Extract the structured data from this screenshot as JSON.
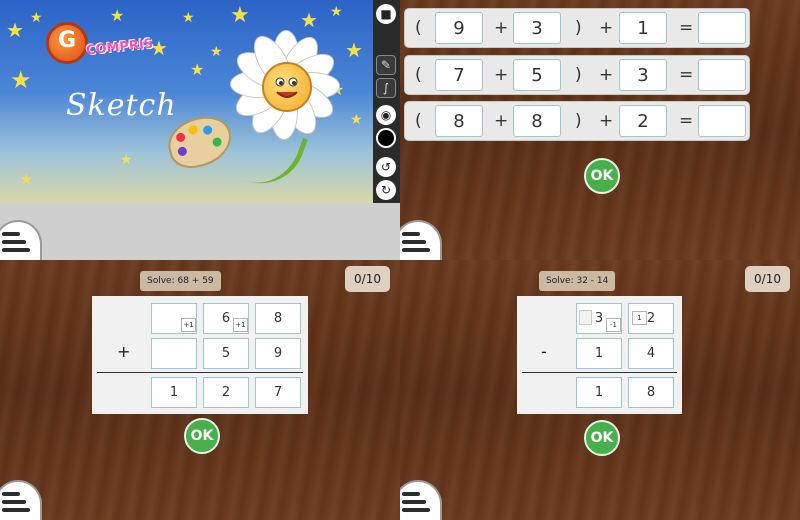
{
  "sketch": {
    "logo_letter": "G",
    "logo_text": "COMPRIS",
    "title": "Sketch",
    "tools": [
      "stop-icon",
      "page-icon",
      "brush-icon",
      "palette-icon",
      "color-black-icon",
      "undo-icon",
      "redo-icon"
    ]
  },
  "equations": {
    "rows": [
      {
        "open": "(",
        "a": "9",
        "op1": "+",
        "b": "3",
        "close": ")",
        "op2": "+",
        "c": "1",
        "eq": "=",
        "answer": ""
      },
      {
        "open": "(",
        "a": "7",
        "op1": "+",
        "b": "5",
        "close": ")",
        "op2": "+",
        "c": "3",
        "eq": "=",
        "answer": ""
      },
      {
        "open": "(",
        "a": "8",
        "op1": "+",
        "b": "8",
        "close": ")",
        "op2": "+",
        "c": "2",
        "eq": "=",
        "answer": ""
      }
    ],
    "ok_label": "OK"
  },
  "addition": {
    "prompt": "Solve: 68 + 59",
    "score": "0/10",
    "operator": "+",
    "row1": [
      "",
      "6",
      "8"
    ],
    "row1_carries": [
      "+1",
      "+1"
    ],
    "row2": [
      "",
      "5",
      "9"
    ],
    "result": [
      "1",
      "2",
      "7"
    ],
    "ok_label": "OK"
  },
  "subtraction": {
    "prompt": "Solve: 32 - 14",
    "score": "0/10",
    "operator": "-",
    "row1": [
      "3",
      "2"
    ],
    "row1_borrow_tens": "-1",
    "row1_borrow_units": "1",
    "row2": [
      "1",
      "4"
    ],
    "result": [
      "1",
      "8"
    ],
    "ok_label": "OK"
  },
  "colors": {
    "ok_green": "#48b04a",
    "wood": "#5b2f17",
    "star": "#f6e04a",
    "brand_pink": "#f64eb4"
  }
}
